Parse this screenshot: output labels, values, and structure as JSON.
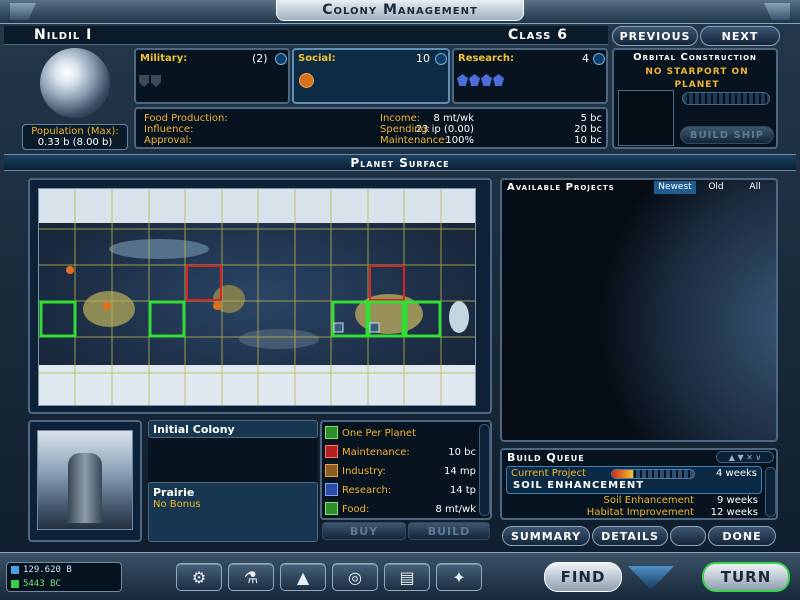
{
  "header": {
    "title": "Colony Management"
  },
  "planet": {
    "name": "Nildil I",
    "class": "Class 6",
    "population_label": "Population (Max):",
    "population_value": "0.33 b (8.00 b)"
  },
  "nav": {
    "previous": "Previous",
    "next": "Next"
  },
  "military": {
    "label": "Military:",
    "value": "(2)"
  },
  "social": {
    "label": "Social:",
    "value": "10"
  },
  "research": {
    "label": "Research:",
    "value": "4"
  },
  "stats": {
    "food_label": "Food Production:",
    "food_value": "8 mt/wk",
    "influence_label": "Influence:",
    "influence_value": "23 ip (0.00)",
    "approval_label": "Approval:",
    "approval_value": "100%",
    "income_label": "Income:",
    "income_value": "5 bc",
    "spending_label": "Spending:",
    "spending_value": "20 bc",
    "maintenance_label": "Maintenance:",
    "maintenance_value": "10 bc"
  },
  "orbital": {
    "title": "Orbital Construction",
    "message": "No starport on planet",
    "build_ship": "Build Ship"
  },
  "surface": {
    "title": "Planet Surface"
  },
  "projects": {
    "title": "Available Projects",
    "tabs": [
      "Newest",
      "Old",
      "All"
    ]
  },
  "tile": {
    "name": "Initial Colony",
    "terrain": "Prairie",
    "bonus": "No Bonus"
  },
  "details": {
    "one_per_planet": "One Per Planet",
    "maintenance_label": "Maintenance:",
    "maintenance_value": "10 bc",
    "industry_label": "Industry:",
    "industry_value": "14 mp",
    "research_label": "Research:",
    "research_value": "14 tp",
    "food_label": "Food:",
    "food_value": "8 mt/wk",
    "buy": "Buy",
    "build": "Build"
  },
  "queue": {
    "title": "Build Queue",
    "current_label": "Current Project",
    "current_time": "4 weeks",
    "current_name": "Soil Enhancement",
    "progress": 0.25,
    "items": [
      {
        "name": "Soil Enhancement",
        "time": "9 weeks"
      },
      {
        "name": "Habitat Improvement",
        "time": "12 weeks"
      }
    ]
  },
  "bottom": {
    "summary": "Summary",
    "details": "Details",
    "done": "Done"
  },
  "status": {
    "population": "129.620 B",
    "credits": "5443 BC"
  },
  "footer": {
    "find": "Find",
    "turn": "Turn"
  },
  "colors": {
    "accent": "#f2c233",
    "panel_bg": "#07131f",
    "border": "#4d6880",
    "tile_owned": "#33dd33",
    "tile_selected": "#dd2222"
  }
}
